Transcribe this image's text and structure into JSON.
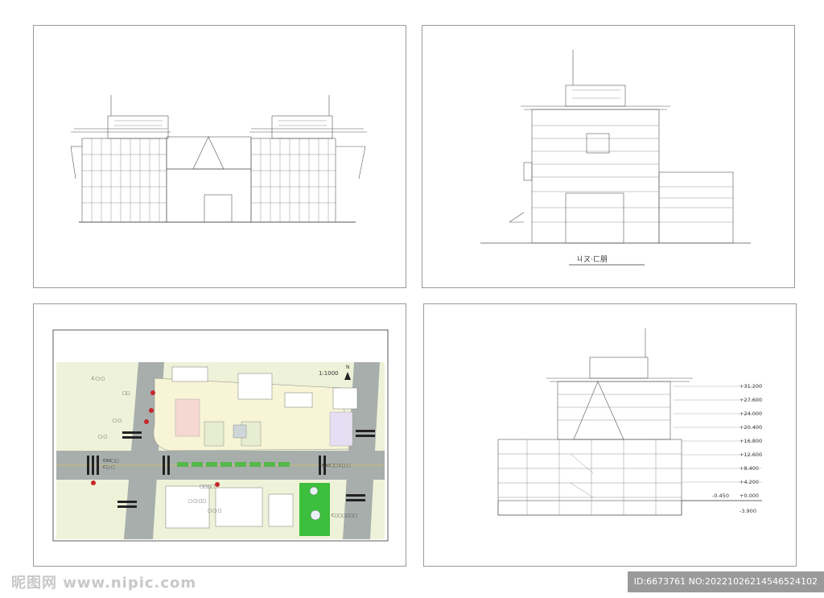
{
  "side_elevation": {
    "caption": "ㄐㄡ·ㄈ朋"
  },
  "site_plan": {
    "scale": "1:1000",
    "north": "N",
    "road_labels": [
      "C·□·□",
      "ЄΑ0□□",
      "C□·□",
      "ЄΑ0□□ C□·□"
    ],
    "small_labels": [
      "□□",
      "□·□",
      "□·□",
      "□·□·□□",
      "□□□□",
      "□·□·□",
      "C□□□□□□"
    ]
  },
  "section": {
    "elevations": [
      "+31.200",
      "+27.600",
      "+24.000",
      "+20.400",
      "+16.800",
      "+12.600",
      "+8.400",
      "+4.200",
      "+0.000",
      "-3.900"
    ],
    "ground_marker": "-0.450"
  },
  "watermark": {
    "left": "昵图网 www.nipic.com",
    "right": "ID:6673761 NO:20221026214546524102"
  }
}
